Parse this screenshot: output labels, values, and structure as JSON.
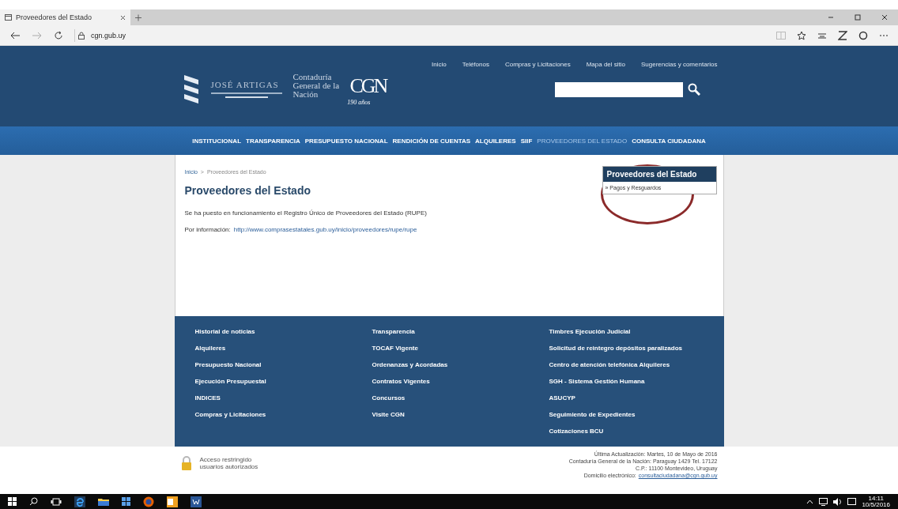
{
  "browser": {
    "tab": {
      "title": "Proveedores del Estado",
      "selected": true
    },
    "address": {
      "host": "cgn.gub.uy"
    }
  },
  "header": {
    "top_links": [
      "Inicio",
      "Teléfonos",
      "Compras y Licitaciones",
      "Mapa del sitio",
      "Sugerencias y comentarios"
    ],
    "logo": {
      "artigas_title": "JOSÉ ARTIGAS",
      "cgn_name": "Contaduría General de la Nación",
      "monogram": "CGN",
      "anniversary": "190 años"
    }
  },
  "nav": [
    {
      "label": "INSTITUCIONAL",
      "selected": false
    },
    {
      "label": "TRANSPARENCIA",
      "selected": false
    },
    {
      "label": "PRESUPUESTO NACIONAL",
      "selected": false
    },
    {
      "label": "RENDICIÓN DE CUENTAS",
      "selected": false
    },
    {
      "label": "ALQUILERES",
      "selected": false
    },
    {
      "label": "SIIF",
      "selected": false
    },
    {
      "label": "PROVEEDORES DEL ESTADO",
      "selected": true
    },
    {
      "label": "CONSULTA CIUDADANA",
      "selected": false
    }
  ],
  "breadcrumb": [
    "Inicio",
    "Proveedores del Estado"
  ],
  "breadcrumb_separator": ">",
  "content": {
    "title": "Proveedores del Estado",
    "paragraph": "Se ha puesto en funcionamiento el Registro Único de Proveedores del Estado (RUPE)",
    "info_label": "Por información:",
    "info_link": "http://www.comprasestatales.gub.uy/inicio/proveedores/rupe/rupe"
  },
  "sidebar": {
    "title": "Proveedores del Estado",
    "items": [
      "» Pagos y Resguardos"
    ]
  },
  "footer_columns": [
    [
      "Historial de noticias",
      "Alquileres",
      "Presupuesto Nacional",
      "Ejecución Presupuestal",
      "INDICES",
      "Compras y Licitaciones"
    ],
    [
      "Transparencia",
      "TOCAF Vigente",
      "Ordenanzas y Acordadas",
      "Contratos Vigentes",
      "Concursos",
      "Visite CGN"
    ],
    [
      "Timbres Ejecución Judicial",
      "Solicitud de reintegro depósitos paralizados",
      "Centro de atención telefónica Alquileres",
      "SGH - Sistema Gestión Humana",
      "ASUCYP",
      "Seguimiento de Expedientes",
      "Cotizaciones BCU"
    ]
  ],
  "restricted": {
    "line_1": "Acceso restringido",
    "line_2": "usuarios autorizados"
  },
  "contact": {
    "lines": [
      "Última Actualización: Martes, 10 de Mayo de 2016",
      "Contaduría General de la Nación: Paraguay 1429 Tel. 17122",
      "C.P.: 11100 Montevideo, Uruguay"
    ],
    "email_label": "Domicilio electrónico:",
    "email": "consultaciudadana@cgn.gub.uy"
  },
  "taskbar": {
    "time": "14:11",
    "date": "10/5/2016"
  }
}
